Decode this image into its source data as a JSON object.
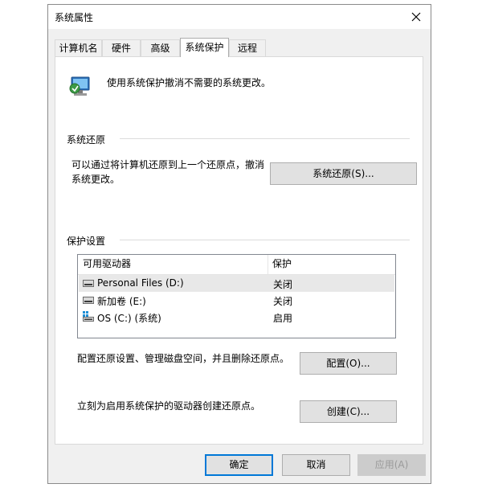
{
  "window": {
    "title": "系统属性"
  },
  "tabs": [
    {
      "label": "计算机名"
    },
    {
      "label": "硬件"
    },
    {
      "label": "高级"
    },
    {
      "label": "系统保护"
    },
    {
      "label": "远程"
    }
  ],
  "active_tab": "系统保护",
  "intro": {
    "text": "使用系统保护撤消不需要的系统更改。"
  },
  "system_restore": {
    "section_label": "系统还原",
    "description": "可以通过将计算机还原到上一个还原点，撤消系统更改。",
    "button_label": "系统还原(S)..."
  },
  "protection": {
    "section_label": "保护设置",
    "columns": {
      "drive": "可用驱动器",
      "protection": "保护"
    },
    "drives": [
      {
        "name": "Personal Files (D:)",
        "status": "关闭",
        "icon": "drive-icon",
        "selected": true
      },
      {
        "name": "新加卷 (E:)",
        "status": "关闭",
        "icon": "drive-icon",
        "selected": false
      },
      {
        "name": "OS (C:) (系统)",
        "status": "启用",
        "icon": "system-drive-icon",
        "selected": false
      }
    ],
    "configure_description": "配置还原设置、管理磁盘空间，并且删除还原点。",
    "configure_button": "配置(O)...",
    "create_description": "立刻为启用系统保护的驱动器创建还原点。",
    "create_button": "创建(C)..."
  },
  "footer": {
    "ok": "确定",
    "cancel": "取消",
    "apply": "应用(A)"
  },
  "colors": {
    "accent": "#0078d7",
    "panel": "#ffffff",
    "chrome": "#f0f0f0",
    "selection": "#e8e8e8"
  }
}
